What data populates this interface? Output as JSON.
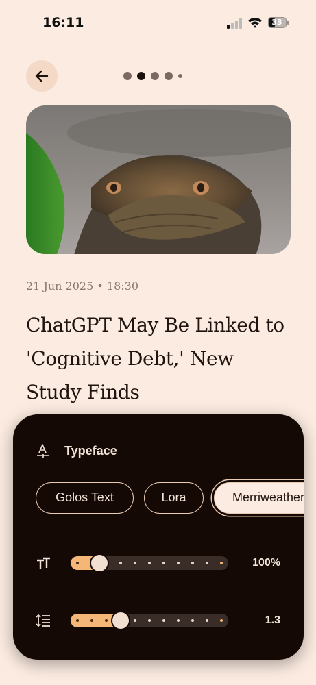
{
  "status_bar": {
    "time": "16:11",
    "battery": "33"
  },
  "nav": {
    "back_icon": "arrow-left-icon",
    "pages": 5,
    "active_page": 2
  },
  "article": {
    "meta": "21 Jun 2025 • 18:30",
    "title": "ChatGPT May Be Linked to 'Cognitive Debt,' New Study Finds",
    "image_alt": "Crocodile in water"
  },
  "settings": {
    "typeface_label": "Typeface",
    "fonts": [
      "Golos Text",
      "Lora",
      "Merriweather"
    ],
    "selected_font": "Merriweather",
    "font_size": {
      "value_label": "100%",
      "position": 0.15,
      "ticks": 11
    },
    "line_height": {
      "value_label": "1.3",
      "position": 0.3,
      "ticks": 11
    }
  },
  "colors": {
    "background": "#fbebe0",
    "sheet": "#150905",
    "accent": "#f4b777",
    "chip_border": "#e9cab3"
  }
}
